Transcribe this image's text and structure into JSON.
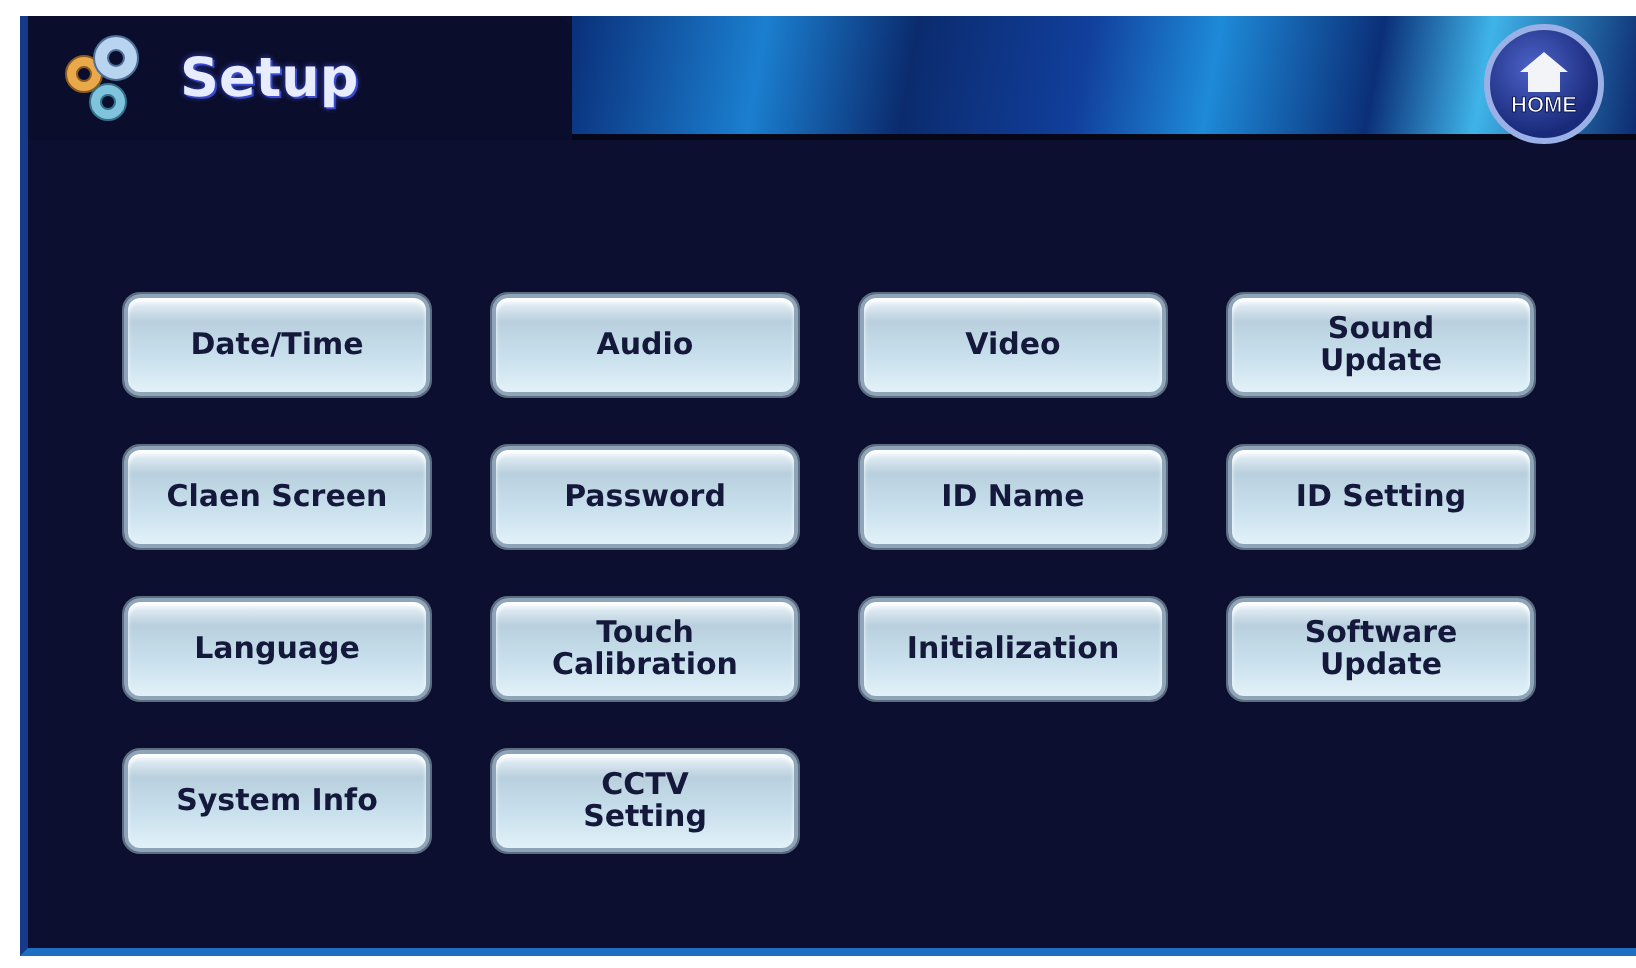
{
  "header": {
    "title": "Setup",
    "home_button": "HOME"
  },
  "buttons": [
    {
      "label": "Date/Time"
    },
    {
      "label": "Audio"
    },
    {
      "label": "Video"
    },
    {
      "label": "Sound\nUpdate"
    },
    {
      "label": "Claen Screen"
    },
    {
      "label": "Password"
    },
    {
      "label": "ID Name"
    },
    {
      "label": "ID Setting"
    },
    {
      "label": "Language"
    },
    {
      "label": "Touch\nCalibration"
    },
    {
      "label": "Initialization"
    },
    {
      "label": "Software\nUpdate"
    },
    {
      "label": "System Info"
    },
    {
      "label": "CCTV\nSetting"
    }
  ]
}
